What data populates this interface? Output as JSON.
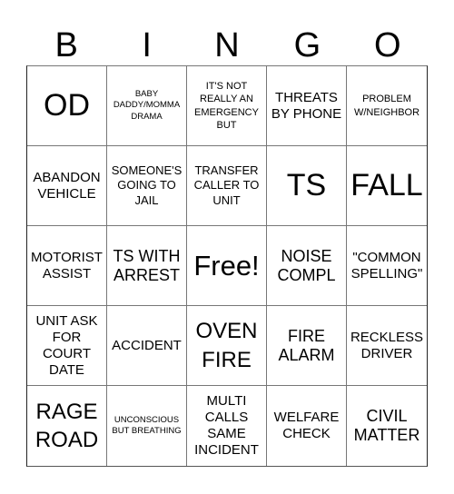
{
  "header": {
    "letters": [
      "B",
      "I",
      "N",
      "G",
      "O"
    ]
  },
  "cells": [
    {
      "text": "OD",
      "size": "s-xl"
    },
    {
      "text": "BABY DADDY/MOMMA DRAMA",
      "size": "s-xxs"
    },
    {
      "text": "IT'S NOT REALLY AN EMERGENCY BUT",
      "size": "s-xs"
    },
    {
      "text": "THREATS BY PHONE",
      "size": "s-sm"
    },
    {
      "text": "PROBLEM W/NEIGHBOR",
      "size": "s-xs"
    },
    {
      "text": "ABANDON VEHICLE",
      "size": "s-sm"
    },
    {
      "text": "SOMEONE'S GOING TO JAIL",
      "size": "s-s"
    },
    {
      "text": "TRANSFER CALLER TO UNIT",
      "size": "s-s"
    },
    {
      "text": "TS",
      "size": "s-xl"
    },
    {
      "text": "FALL",
      "size": "s-xl"
    },
    {
      "text": "MOTORIST ASSIST",
      "size": "s-sm"
    },
    {
      "text": "TS WITH ARREST",
      "size": "s-m"
    },
    {
      "text": "Free!",
      "size": "free"
    },
    {
      "text": "NOISE COMPL",
      "size": "s-m"
    },
    {
      "text": "\"COMMON SPELLING\"",
      "size": "s-sm"
    },
    {
      "text": "UNIT ASK FOR COURT DATE",
      "size": "s-sm"
    },
    {
      "text": "ACCIDENT",
      "size": "s-sm"
    },
    {
      "text": "OVEN FIRE",
      "size": "s-l"
    },
    {
      "text": "FIRE ALARM",
      "size": "s-m"
    },
    {
      "text": "RECKLESS DRIVER",
      "size": "s-sm"
    },
    {
      "text": "RAGE ROAD",
      "size": "s-l"
    },
    {
      "text": "UNCONSCIOUS BUT BREATHING",
      "size": "s-xxs"
    },
    {
      "text": "MULTI CALLS SAME INCIDENT",
      "size": "s-sm"
    },
    {
      "text": "WELFARE CHECK",
      "size": "s-sm"
    },
    {
      "text": "CIVIL MATTER",
      "size": "s-m"
    }
  ]
}
